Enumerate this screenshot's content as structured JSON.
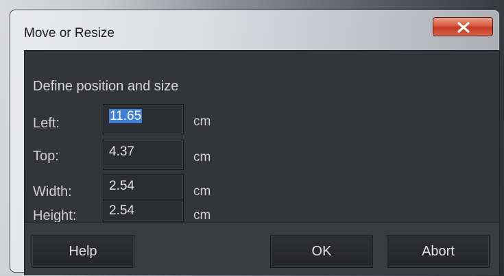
{
  "dialog": {
    "title": "Move or Resize",
    "close_icon": "close-x-icon",
    "heading": "Define position and size"
  },
  "fields": {
    "left": {
      "label": "Left:",
      "value": "11.65",
      "unit": "cm",
      "selected": true
    },
    "top": {
      "label": "Top:",
      "value": "4.37",
      "unit": "cm"
    },
    "width": {
      "label": "Width:",
      "value": "2.54",
      "unit": "cm"
    },
    "height": {
      "label": "Height:",
      "value": "2.54",
      "unit": "cm"
    }
  },
  "buttons": {
    "help": "Help",
    "ok": "OK",
    "abort": "Abort"
  },
  "colors": {
    "close_button": "#d7553d",
    "dialog_body": "#343538",
    "selection": "#3f7fd5"
  }
}
